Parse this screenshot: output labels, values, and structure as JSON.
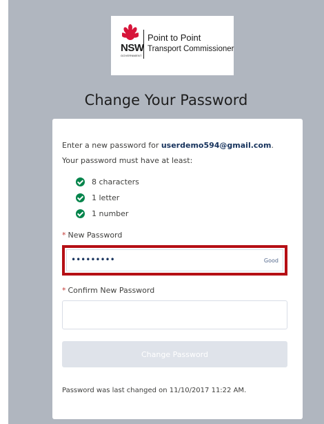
{
  "logo": {
    "nsw_text": "NSW",
    "government_text": "GOVERNMENT",
    "line1": "Point to Point",
    "line2": "Transport Commissioner"
  },
  "page_title": "Change Your Password",
  "intro": {
    "prefix": "Enter a new password for ",
    "email": "userdemo594@gmail.com",
    "suffix": ".",
    "requirements_heading": "Your password must have at least:"
  },
  "requirements": [
    "8 characters",
    "1 letter",
    "1 number"
  ],
  "new_password": {
    "label": "New Password",
    "value": "•••••••••",
    "strength": "Good"
  },
  "confirm_password": {
    "label": "Confirm New Password",
    "value": ""
  },
  "change_button_label": "Change Password",
  "footer_note": "Password was last changed on 11/10/2017 11:22 AM.",
  "colors": {
    "background": "#b0b6bf",
    "check": "#04844b",
    "highlight_border": "#b50f15",
    "required_star": "#c23934",
    "email_text": "#16325c",
    "button_disabled": "#dfe3ea"
  },
  "icons": {
    "requirement_met": "check-circle-icon",
    "logo_emblem": "waratah-icon"
  }
}
